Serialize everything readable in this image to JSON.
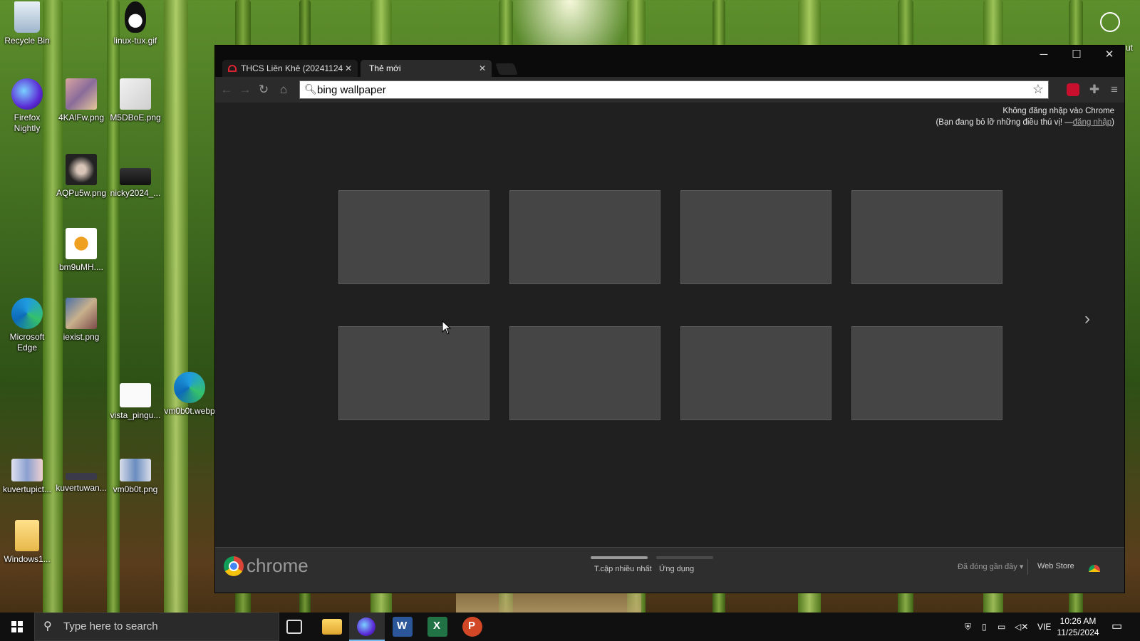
{
  "desktop": {
    "icons": [
      {
        "label": "Recycle Bin"
      },
      {
        "label": "linux-tux.gif"
      },
      {
        "label": "Firefox Nightly"
      },
      {
        "label": "4KAlFw.png"
      },
      {
        "label": "M5DBoE.png"
      },
      {
        "label": "AQPu5w.png"
      },
      {
        "label": "nicky2024_..."
      },
      {
        "label": "bm9uMH...."
      },
      {
        "label": "Microsoft Edge"
      },
      {
        "label": "iexist.png"
      },
      {
        "label": "vista_pingu..."
      },
      {
        "label": "vm0b0t.webp"
      },
      {
        "label": "kuvertupict..."
      },
      {
        "label": "kuvertuwan..."
      },
      {
        "label": "vm0b0t.png"
      },
      {
        "label": "Windows1..."
      }
    ],
    "corner_label": "ut"
  },
  "browser": {
    "tabs": [
      {
        "label": "THCS Liên Khê (20241124",
        "active": false
      },
      {
        "label": "Thẻ mới",
        "active": true
      }
    ],
    "omnibox": {
      "value": "bing wallpaper"
    },
    "signin": {
      "line1": "Không đăng nhập vào Chrome",
      "line2_prefix": "(Bạn đang bỏ lỡ những điều thú vị! —",
      "link": "đăng nhập",
      "line2_suffix": ")"
    },
    "footer": {
      "brand": "chrome",
      "most_visited": "T.cập nhiều nhất",
      "apps": "Ứng dụng",
      "recently_closed": "Đã đóng gần đây",
      "web_store": "Web Store"
    }
  },
  "taskbar": {
    "search_placeholder": "Type here to search",
    "language": "VIE",
    "time": "10:26 AM",
    "date": "11/25/2024"
  },
  "colors": {
    "accent_blue": "#4285f4",
    "ublock_red": "#c8102e",
    "thumb_bg": "#454545"
  }
}
